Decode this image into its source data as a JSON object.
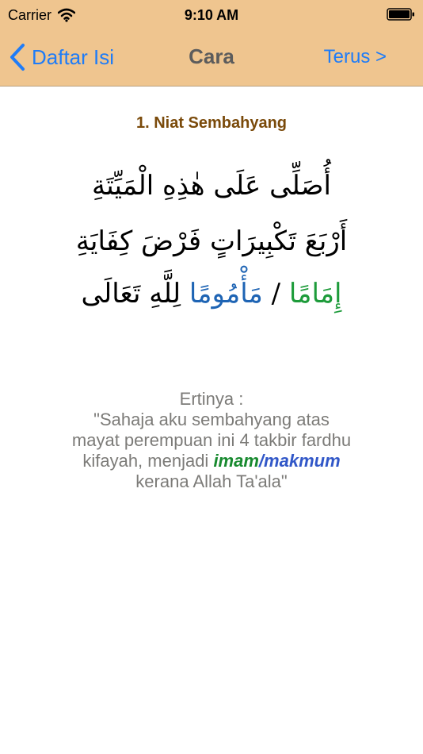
{
  "status_bar": {
    "carrier": "Carrier",
    "time": "9:10 AM"
  },
  "navbar": {
    "back_label": "Daftar Isi",
    "title": "Cara",
    "forward_label": "Terus >"
  },
  "content": {
    "section_title": "1. Niat Sembahyang",
    "arabic": {
      "line1": "أُصَلِّى عَلَى هٰذِهِ الْمَيِّتَةِ",
      "line2": "أَرْبَعَ تَكْبِيرَاتٍ فَرْضَ كِفَايَةِ",
      "line3_green": "إِمَامًا",
      "line3_sep": " / ",
      "line3_blue": "مَأْمُومًا",
      "line3_rest": " لِلَّهِ تَعَالَى"
    },
    "translation": {
      "heading": "Ertinya :",
      "line1": "\"Sahaja aku sembahyang atas",
      "line2": "mayat perempuan ini 4 takbir fardhu",
      "line3_prefix": "kifayah, menjadi ",
      "imam": "imam",
      "slash": "/",
      "makmum": "makmum",
      "line4": "kerana Allah Ta'ala\""
    }
  },
  "colors": {
    "header_bg": "#efc58f",
    "link_blue": "#1f7cf7",
    "title_brown": "#7a4a0a",
    "imam_green": "#1d9b3a",
    "makmum_blue": "#1e64b4"
  },
  "icons": {
    "wifi": "wifi-icon",
    "battery": "battery-icon",
    "back": "chevron-left-icon"
  }
}
